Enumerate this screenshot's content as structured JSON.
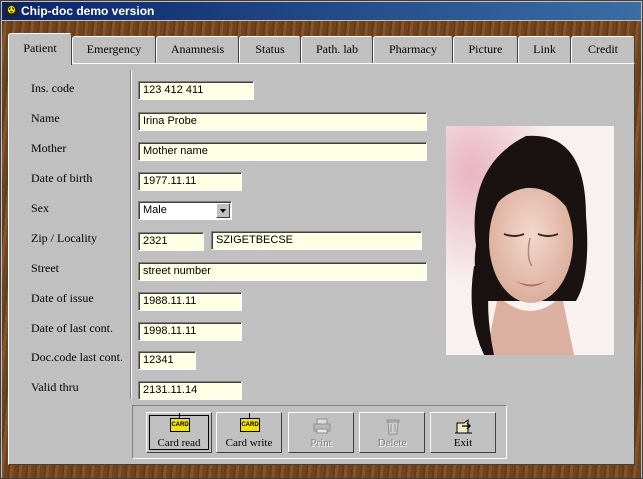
{
  "window": {
    "title": "Chip-doc demo version"
  },
  "tabs": [
    {
      "label": "Patient"
    },
    {
      "label": "Emergency"
    },
    {
      "label": "Anamnesis"
    },
    {
      "label": "Status"
    },
    {
      "label": "Path. lab"
    },
    {
      "label": "Pharmacy"
    },
    {
      "label": "Picture"
    },
    {
      "label": "Link"
    },
    {
      "label": "Credit"
    }
  ],
  "active_tab": "Patient",
  "form": {
    "ins_code": {
      "label": "Ins. code",
      "value": "123 412 411"
    },
    "name": {
      "label": "Name",
      "value": "Irina Probe"
    },
    "mother": {
      "label": "Mother",
      "value": "Mother name"
    },
    "dob": {
      "label": "Date of  birth",
      "value": "1977.11.11"
    },
    "sex": {
      "label": "Sex",
      "value": "Male"
    },
    "zip": {
      "label": "Zip / Locality",
      "value": "2321",
      "locality": "SZIGETBECSE"
    },
    "street": {
      "label": "Street",
      "value": "street number"
    },
    "date_issue": {
      "label": "Date of issue",
      "value": "1988.11.11"
    },
    "date_last": {
      "label": "Date of last cont.",
      "value": "1998.11.11"
    },
    "doc_code": {
      "label": "Doc.code last cont.",
      "value": "12341"
    },
    "valid_thru": {
      "label": "Valid thru",
      "value": "2131.11.14"
    }
  },
  "buttons": {
    "card_read": {
      "label": "Card read",
      "icon_text": "CARD"
    },
    "card_write": {
      "label": "Card write",
      "icon_text": "CARD"
    },
    "print": {
      "label": "Print"
    },
    "delete": {
      "label": "Delete"
    },
    "exit": {
      "label": "Exit"
    }
  },
  "colors": {
    "field_bg": "#ffffe6",
    "title_start": "#0a246a",
    "title_end": "#3a6ea5"
  }
}
